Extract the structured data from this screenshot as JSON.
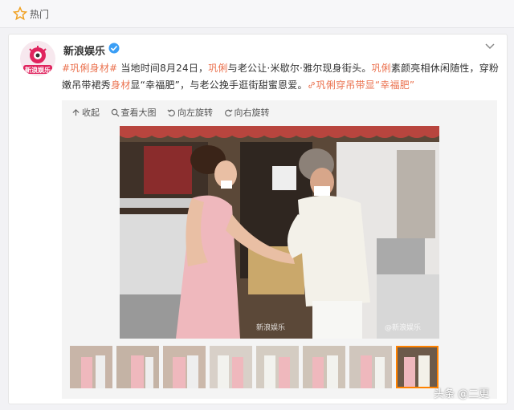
{
  "topbar": {
    "label": "热门",
    "icon": "star-icon"
  },
  "post": {
    "author": "新浪娱乐",
    "avatar_text": "新浪娱乐",
    "text": {
      "tag": "#巩俐身材#",
      "seg1": " 当地时间8月24日，",
      "hl1": "巩俐",
      "seg2": "与老公让·米歇尔·雅尔现身街头。",
      "hl2": "巩俐",
      "seg3": "素颜亮相休闲随性，穿粉嫩吊带裙秀",
      "hl3": "身材",
      "seg4": "显“幸福肥”，与老公挽手逛街甜蜜恩爱。",
      "link": "巩俐穿吊带显“幸福肥”"
    }
  },
  "toolbar": {
    "collapse": "收起",
    "view_large": "查看大图",
    "rotate_left": "向左旋转",
    "rotate_right": "向右旋转"
  },
  "photo": {
    "watermark1": "新浪娱乐",
    "watermark2": "@新浪娱乐"
  },
  "thumbnails_count": 8,
  "active_thumbnail": 8,
  "corner_watermark": "头条 @二更",
  "colors": {
    "accent": "#eb7350",
    "active": "#ff8200"
  }
}
